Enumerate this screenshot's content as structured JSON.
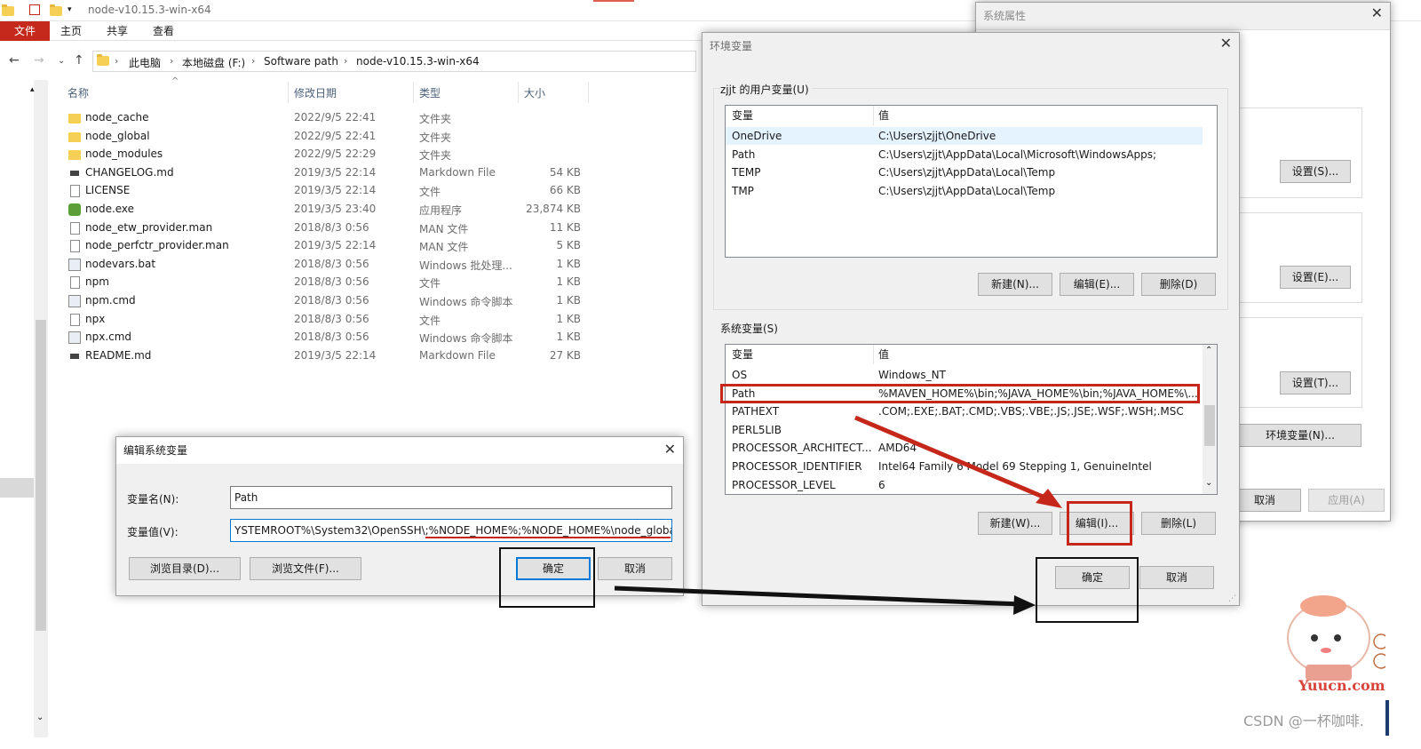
{
  "explorer": {
    "window_title": "node-v10.15.3-win-x64",
    "ribbon_tabs": [
      "文件",
      "主页",
      "共享",
      "查看"
    ],
    "breadcrumb": [
      "此电脑",
      "本地磁盘 (F:)",
      "Software path",
      "node-v10.15.3-win-x64"
    ],
    "columns": {
      "name": "名称",
      "date": "修改日期",
      "type": "类型",
      "size": "大小"
    },
    "files": [
      {
        "name": "node_cache",
        "date": "2022/9/5 22:41",
        "type": "文件夹",
        "size": "",
        "icon": "folder-icon"
      },
      {
        "name": "node_global",
        "date": "2022/9/5 22:41",
        "type": "文件夹",
        "size": "",
        "icon": "folder-icon"
      },
      {
        "name": "node_modules",
        "date": "2022/9/5 22:29",
        "type": "文件夹",
        "size": "",
        "icon": "folder-icon"
      },
      {
        "name": "CHANGELOG.md",
        "date": "2019/3/5 22:14",
        "type": "Markdown File",
        "size": "54 KB",
        "icon": "markdown-icon"
      },
      {
        "name": "LICENSE",
        "date": "2019/3/5 22:14",
        "type": "文件",
        "size": "66 KB",
        "icon": "file-icon"
      },
      {
        "name": "node.exe",
        "date": "2019/3/5 23:40",
        "type": "应用程序",
        "size": "23,874 KB",
        "icon": "node-exe-icon"
      },
      {
        "name": "node_etw_provider.man",
        "date": "2018/8/3 0:56",
        "type": "MAN 文件",
        "size": "11 KB",
        "icon": "file-icon"
      },
      {
        "name": "node_perfctr_provider.man",
        "date": "2019/3/5 22:14",
        "type": "MAN 文件",
        "size": "5 KB",
        "icon": "file-icon"
      },
      {
        "name": "nodevars.bat",
        "date": "2018/8/3 0:56",
        "type": "Windows 批处理...",
        "size": "1 KB",
        "icon": "batch-icon"
      },
      {
        "name": "npm",
        "date": "2018/8/3 0:56",
        "type": "文件",
        "size": "1 KB",
        "icon": "file-icon"
      },
      {
        "name": "npm.cmd",
        "date": "2018/8/3 0:56",
        "type": "Windows 命令脚本",
        "size": "1 KB",
        "icon": "batch-icon"
      },
      {
        "name": "npx",
        "date": "2018/8/3 0:56",
        "type": "文件",
        "size": "1 KB",
        "icon": "file-icon"
      },
      {
        "name": "npx.cmd",
        "date": "2018/8/3 0:56",
        "type": "Windows 命令脚本",
        "size": "1 KB",
        "icon": "batch-icon"
      },
      {
        "name": "README.md",
        "date": "2019/3/5 22:14",
        "type": "Markdown File",
        "size": "27 KB",
        "icon": "markdown-icon"
      }
    ]
  },
  "sysprop": {
    "title": "系统属性",
    "buttons": {
      "settings_s": "设置(S)...",
      "settings_e": "设置(E)...",
      "settings_t": "设置(T)...",
      "env_vars": "环境变量(N)...",
      "cancel": "取消",
      "apply": "应用(A)"
    }
  },
  "envdlg": {
    "title": "环境变量",
    "user_group": "zjjt 的用户变量(U)",
    "sys_group": "系统变量(S)",
    "col_var": "变量",
    "col_val": "值",
    "user_vars": [
      {
        "name": "OneDrive",
        "value": "C:\\Users\\zjjt\\OneDrive"
      },
      {
        "name": "Path",
        "value": "C:\\Users\\zjjt\\AppData\\Local\\Microsoft\\WindowsApps;"
      },
      {
        "name": "TEMP",
        "value": "C:\\Users\\zjjt\\AppData\\Local\\Temp"
      },
      {
        "name": "TMP",
        "value": "C:\\Users\\zjjt\\AppData\\Local\\Temp"
      }
    ],
    "sys_vars": [
      {
        "name": "OS",
        "value": "Windows_NT"
      },
      {
        "name": "Path",
        "value": "%MAVEN_HOME%\\bin;%JAVA_HOME%\\bin;%JAVA_HOME%\\..."
      },
      {
        "name": "PATHEXT",
        "value": ".COM;.EXE;.BAT;.CMD;.VBS;.VBE;.JS;.JSE;.WSF;.WSH;.MSC"
      },
      {
        "name": "PERL5LIB",
        "value": ""
      },
      {
        "name": "PROCESSOR_ARCHITECT...",
        "value": "AMD64"
      },
      {
        "name": "PROCESSOR_IDENTIFIER",
        "value": "Intel64 Family 6 Model 69 Stepping 1, GenuineIntel"
      },
      {
        "name": "PROCESSOR_LEVEL",
        "value": "6"
      }
    ],
    "user_buttons": {
      "new": "新建(N)...",
      "edit": "编辑(E)...",
      "delete": "删除(D)"
    },
    "sys_buttons": {
      "new": "新建(W)...",
      "edit": "编辑(I)...",
      "delete": "删除(L)"
    },
    "ok": "确定",
    "cancel": "取消"
  },
  "editdlg": {
    "title": "编辑系统变量",
    "name_label": "变量名(N):",
    "name_value": "Path",
    "value_label": "变量值(V):",
    "value_value": "YSTEMROOT%\\System32\\OpenSSH\\;%NODE_HOME%;%NODE_HOME%\\node_global;",
    "browse_dir": "浏览目录(D)...",
    "browse_file": "浏览文件(F)...",
    "ok": "确定",
    "cancel": "取消"
  },
  "watermark": {
    "text": "CSDN @一杯咖啡.",
    "logo_text": "Yuucn.com"
  },
  "colors": {
    "file_tab": "#c4291c",
    "annotation_red": "#c6271b",
    "annotation_black": "#111111",
    "selection": "#e5f3ff",
    "button_face": "#e1e1e1"
  }
}
